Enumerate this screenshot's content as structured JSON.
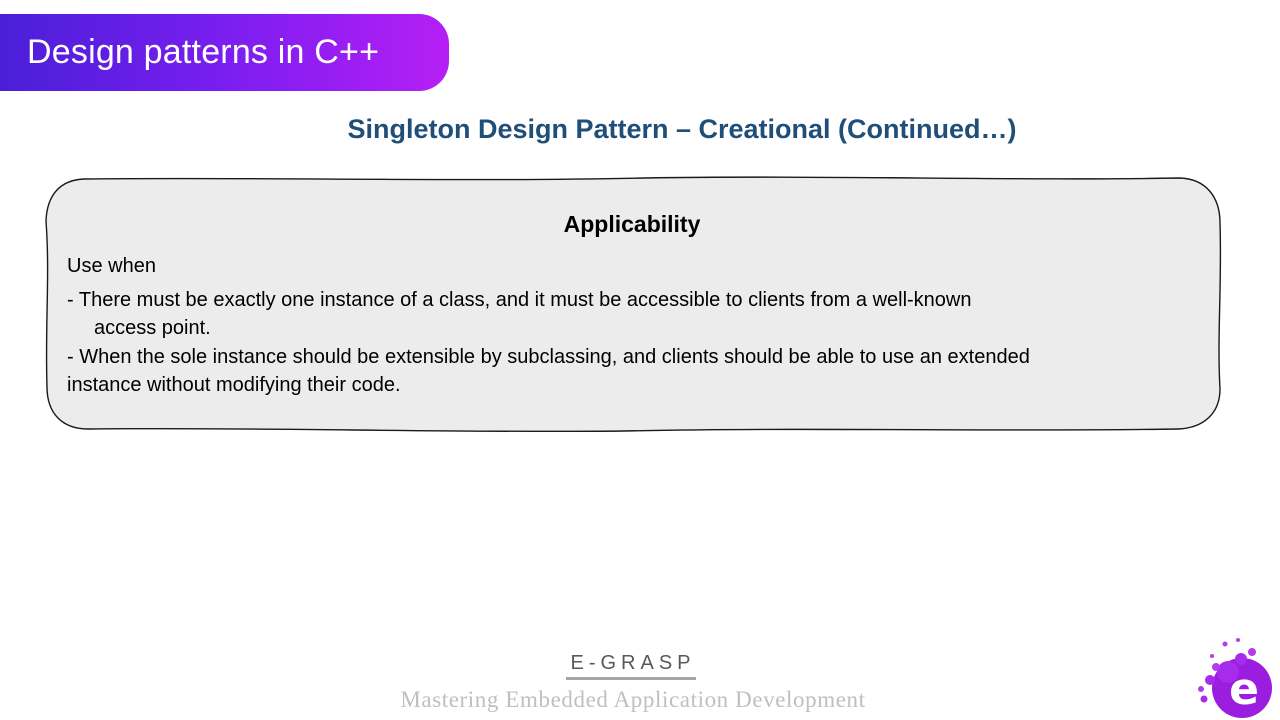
{
  "header": {
    "title": "Design patterns in C++"
  },
  "slide": {
    "title": "Singleton Design Pattern – Creational (Continued…)"
  },
  "applicability": {
    "heading": "Applicability",
    "intro": "Use when",
    "point1_line1": "- There must be exactly one instance of a class, and it must be accessible to clients from a well-known",
    "point1_line2": "access point.",
    "point2_line1": "- When the sole instance should be extensible by subclassing, and clients should be able to use an extended",
    "point2_line2": "instance without modifying their code."
  },
  "footer": {
    "brand": "E-GRASP",
    "tagline": "Mastering Embedded Application Development"
  },
  "logo": {
    "icon": "e-grasp-logo-icon",
    "letter": "e"
  },
  "colors": {
    "banner_start": "#4a1fd8",
    "banner_end": "#b61ff5",
    "title_blue": "#1f4e79",
    "box_fill": "#ececec",
    "logo_purple": "#9b1de0"
  }
}
